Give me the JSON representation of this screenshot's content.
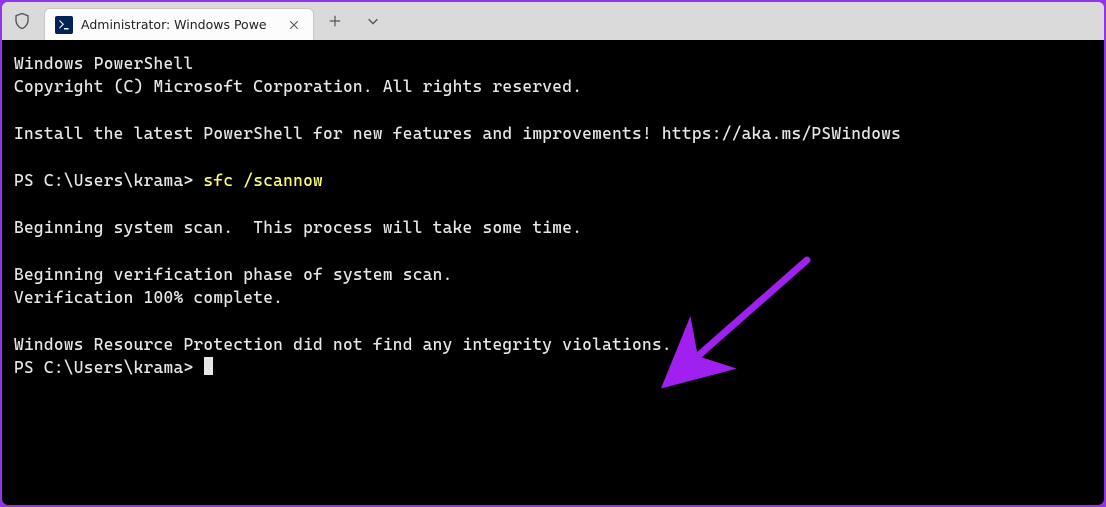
{
  "tab": {
    "title": "Administrator: Windows Powe"
  },
  "terminal": {
    "line1": "Windows PowerShell",
    "line2": "Copyright (C) Microsoft Corporation. All rights reserved.",
    "line3": "Install the latest PowerShell for new features and improvements! https://aka.ms/PSWindows",
    "prompt1": "PS C:\\Users\\krama> ",
    "command": "sfc /scannow",
    "line4": "Beginning system scan.  This process will take some time.",
    "line5": "Beginning verification phase of system scan.",
    "line6": "Verification 100% complete.",
    "line7": "Windows Resource Protection did not find any integrity violations.",
    "prompt2": "PS C:\\Users\\krama> "
  },
  "annotation": {
    "arrow_color": "#a020f0"
  }
}
